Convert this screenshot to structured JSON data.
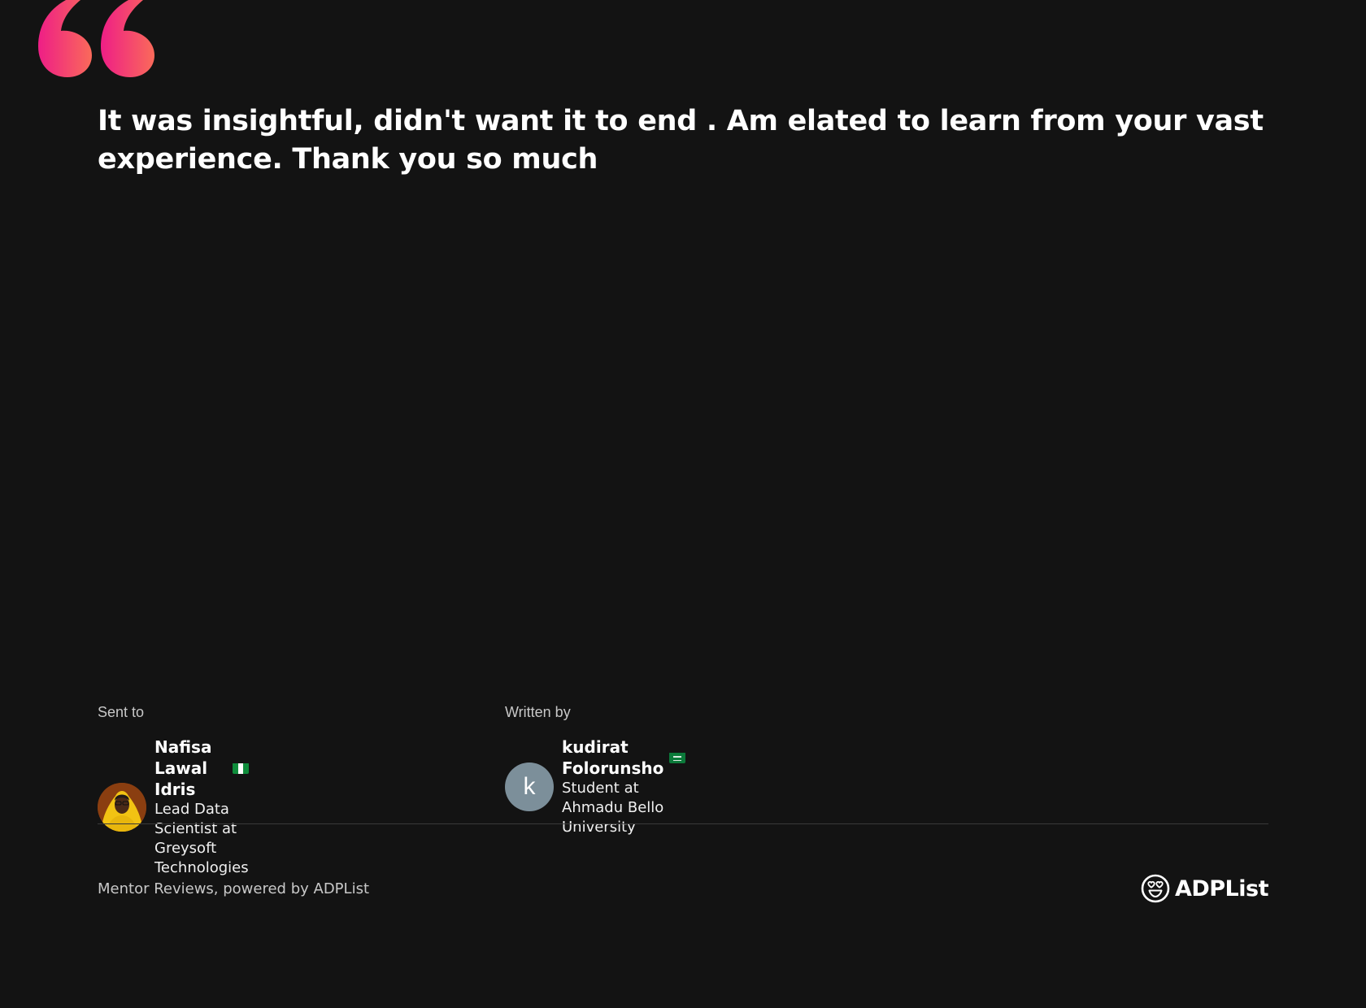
{
  "review": {
    "text": "It was insightful, didn't want it to end . Am elated to learn from your vast experience. Thank you so much"
  },
  "sent_to": {
    "label": "Sent to",
    "name": "Nafisa Lawal Idris",
    "title": "Lead Data Scientist at Greysoft Technologies",
    "flag": "nigeria-flag-icon"
  },
  "written_by": {
    "label": "Written by",
    "avatar_letter": "k",
    "name": "kudirat Folorunsho",
    "title": "Student at Ahmadu Bello University",
    "flag": "saudi-arabia-flag-icon"
  },
  "footer": {
    "powered_by": "Mentor Reviews, powered by ADPList",
    "brand_name": "ADPList"
  },
  "colors": {
    "background": "#131313",
    "quote_gradient_start": "#ee1e86",
    "quote_gradient_end": "#fa6a5a",
    "avatar_letter_bg": "#7c8f9a"
  }
}
